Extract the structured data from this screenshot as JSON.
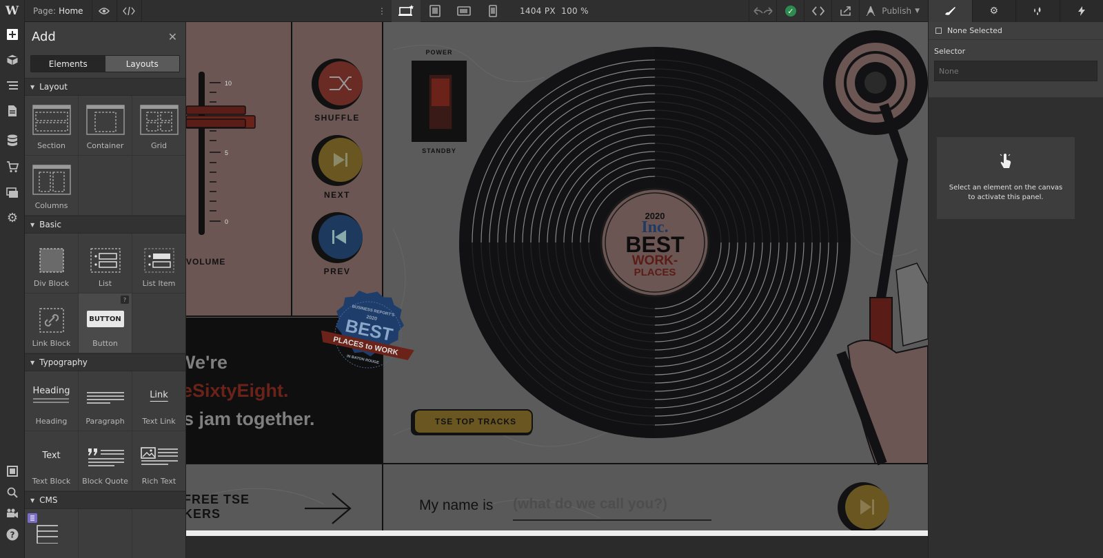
{
  "topbar": {
    "logo": "W",
    "page_label": "Page:",
    "page_name": "Home",
    "size_px": "1404 PX",
    "zoom": "100 %",
    "publish_label": "Publish",
    "status_color": "#2e8b4f"
  },
  "add_panel": {
    "title": "Add",
    "tabs": [
      "Elements",
      "Layouts"
    ],
    "active_tab": "Elements",
    "categories": [
      {
        "name": "Layout",
        "items": [
          "Section",
          "Container",
          "Grid",
          "Columns"
        ]
      },
      {
        "name": "Basic",
        "items": [
          "Div Block",
          "List",
          "List Item",
          "Link Block",
          "Button"
        ]
      },
      {
        "name": "Typography",
        "items": [
          "Heading",
          "Paragraph",
          "Text Link",
          "Text Block",
          "Block Quote",
          "Rich Text"
        ]
      },
      {
        "name": "CMS",
        "items": []
      }
    ],
    "button_preview": "BUTTON",
    "heading_preview": "Heading",
    "link_preview": "Link",
    "text_preview": "Text",
    "help": "?"
  },
  "canvas": {
    "volume_label": "VOLUME",
    "volume_ticks": [
      "10",
      "5",
      "0"
    ],
    "shuffle_label": "SHUFFLE",
    "next_label": "NEXT",
    "prev_label": "PREV",
    "power_label": "POWER",
    "standby_label": "STANDBY",
    "record_year": "2020",
    "record_brand": "Inc.",
    "record_best": "BEST",
    "record_work": "WORK-",
    "record_places": "PLACES",
    "badge_top": "BUSINESS REPORT'S",
    "badge_year": "2020",
    "badge_best": "BEST",
    "badge_ribbon": "PLACES to WORK",
    "badge_bottom": "IN BATON ROUGE",
    "tagline_1": "We're",
    "tagline_2": "eSixtyEight.",
    "tagline_3": "s jam together.",
    "top_tracks": "TSE TOP TRACKS",
    "free_1": "FREE TSE",
    "free_2": "KERS",
    "name_label": "My name is",
    "name_placeholder": "(what do we call you?)"
  },
  "right_panel": {
    "none_selected": "None Selected",
    "selector_label": "Selector",
    "selector_value": "None",
    "hint_1": "Select an element on the canvas",
    "hint_2": "to activate this panel."
  },
  "icons": {
    "rail": [
      "add-icon",
      "cube-icon",
      "navigator-icon",
      "pages-icon",
      "cms-icon",
      "ecommerce-icon",
      "assets-icon",
      "settings-icon",
      "preview-icon",
      "search-icon",
      "video-icon",
      "help-icon"
    ]
  }
}
